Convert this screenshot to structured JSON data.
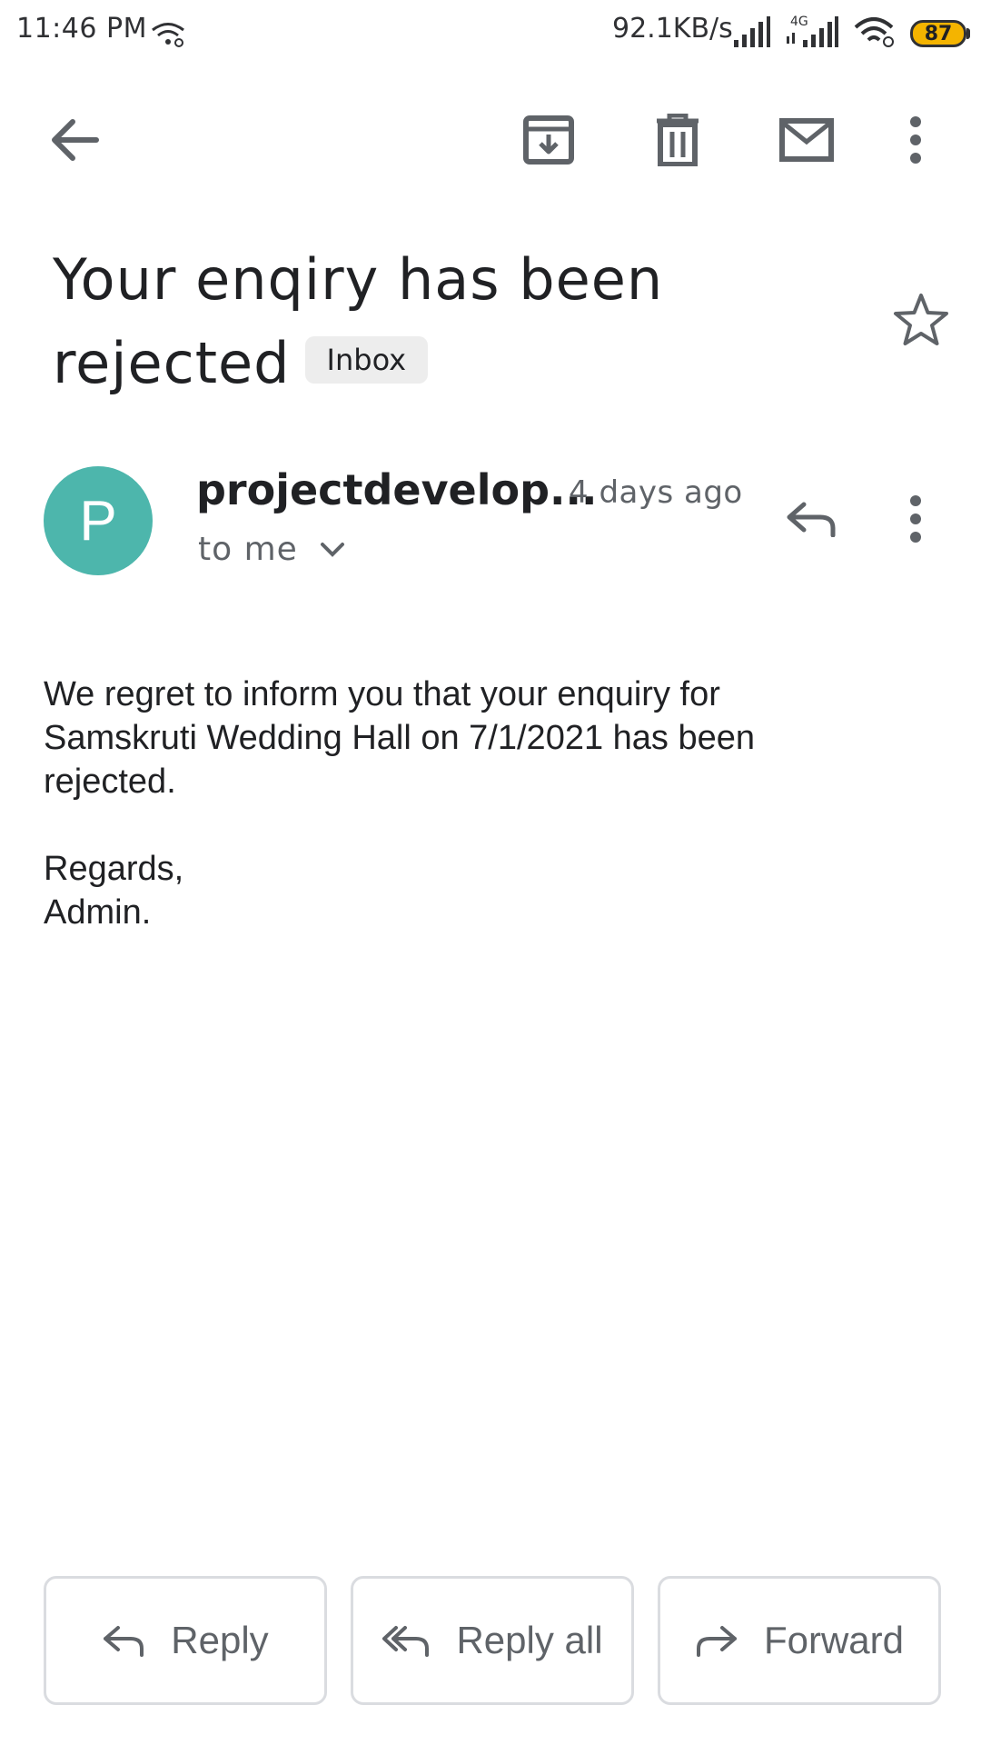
{
  "status_bar": {
    "time": "11:46 PM",
    "network_speed": "92.1KB/s",
    "network_type": "4G",
    "battery": "87",
    "icons": [
      "wifi-link-icon",
      "signal-icon",
      "signal-4g-icon",
      "wifi-icon",
      "battery-icon"
    ]
  },
  "toolbar": {
    "icons": [
      "back-arrow-icon",
      "archive-icon",
      "delete-icon",
      "mark-unread-icon",
      "more-vert-icon"
    ]
  },
  "email": {
    "subject_line1": "Your enqiry has been",
    "subject_line2": "rejected",
    "label": "Inbox",
    "sender_initial": "P",
    "sender_name": "projectdevelop...",
    "time": "4 days ago",
    "recipient": "to me",
    "body": "We regret to inform you that your enquiry for\nSamskruti Wedding Hall on 7/1/2021 has been\nrejected.\n\nRegards,\nAdmin."
  },
  "actions": {
    "reply": "Reply",
    "reply_all": "Reply all",
    "forward": "Forward"
  },
  "colors": {
    "avatar": "#4db6ac",
    "icon": "#5f6368",
    "battery": "#f4b400"
  }
}
